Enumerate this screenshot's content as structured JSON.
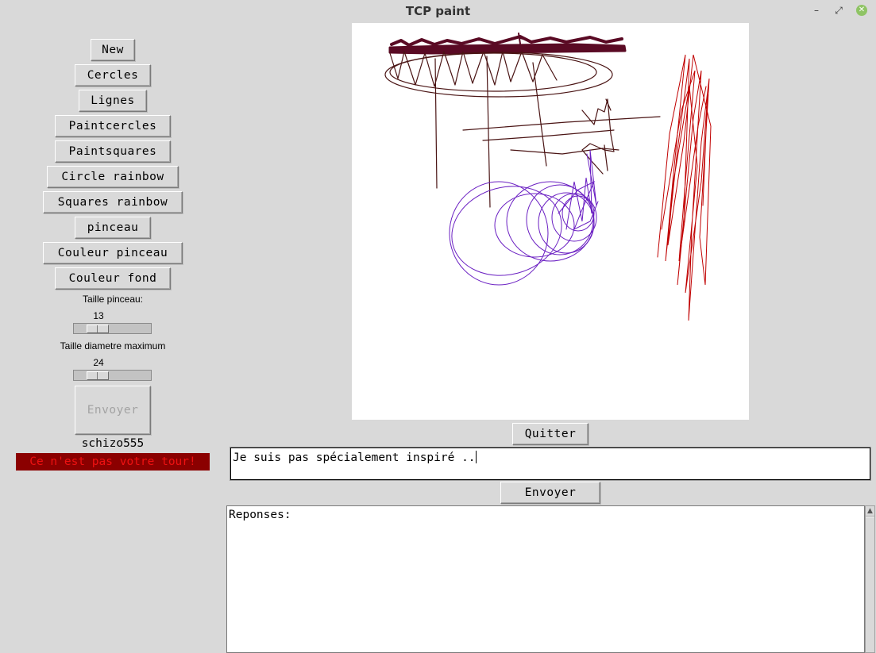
{
  "window": {
    "title": "TCP paint"
  },
  "toolbar": {
    "new_label": "New",
    "cercles_label": "Cercles",
    "lignes_label": "Lignes",
    "paintcercles_label": "Paintcercles",
    "paintsquares_label": "Paintsquares",
    "circle_rainbow_label": "Circle rainbow",
    "squares_rainbow_label": "Squares rainbow",
    "pinceau_label": "pinceau",
    "couleur_pinceau_label": "Couleur pinceau",
    "couleur_fond_label": "Couleur fond"
  },
  "sliders": {
    "brush_size": {
      "label": "Taille pinceau:",
      "value": "13"
    },
    "max_diameter": {
      "label": "Taille diametre maximum",
      "value": "24"
    }
  },
  "left_send_button": {
    "label": "Envoyer",
    "disabled": true
  },
  "user": {
    "username": "schizo555",
    "turn_message": "Ce n'est pas votre tour!"
  },
  "actions": {
    "quit_label": "Quitter",
    "send_label": "Envoyer"
  },
  "message_input": {
    "value": "Je suis pas spécialement inspiré .."
  },
  "responses": {
    "header": "Reponses:"
  },
  "colors": {
    "background": "#d9d9d9",
    "turn_message_bg": "#8b0000",
    "turn_message_text": "#ee1111",
    "stroke_maroon": "#5a0a24",
    "stroke_brown": "#4a1414",
    "stroke_purple": "#6a1fc2",
    "stroke_red": "#c00000"
  }
}
